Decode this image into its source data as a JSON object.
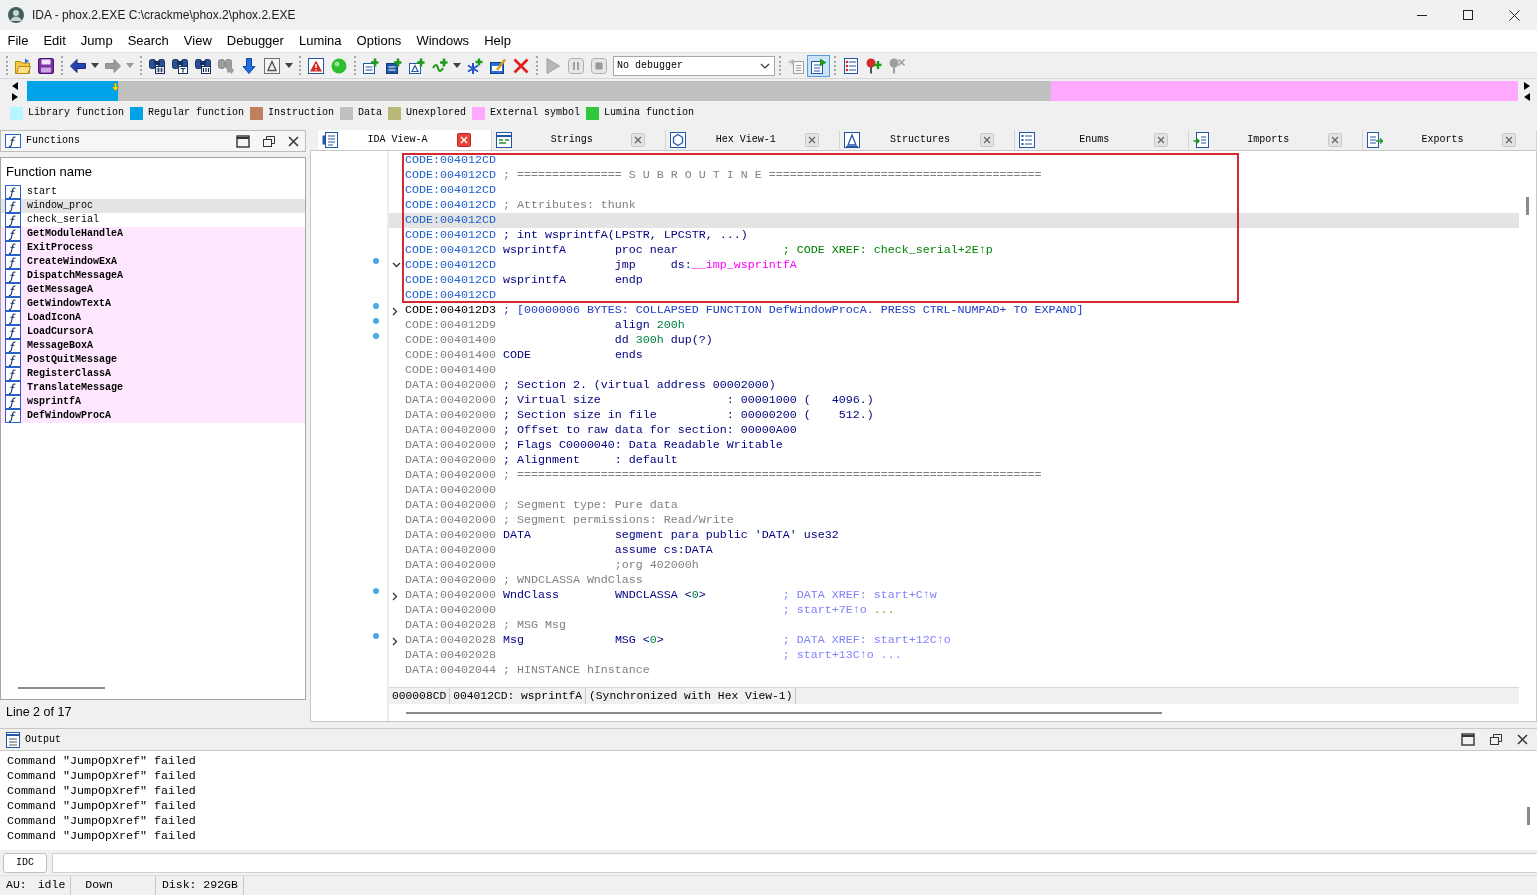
{
  "window": {
    "title": "IDA - phox.2.EXE C:\\crackme\\phox.2\\phox.2.EXE"
  },
  "menu": [
    "File",
    "Edit",
    "Jump",
    "Search",
    "View",
    "Debugger",
    "Lumina",
    "Options",
    "Windows",
    "Help"
  ],
  "toolbar": [
    [
      {
        "kind": "open",
        "disabled": false,
        "pressed": false
      },
      {
        "kind": "save",
        "disabled": false,
        "pressed": false
      }
    ],
    [
      {
        "kind": "back",
        "disabled": false,
        "pressed": false
      },
      {
        "kind": "caret",
        "disabled": false,
        "pressed": false
      },
      {
        "kind": "forward",
        "disabled": true,
        "pressed": false
      },
      {
        "kind": "caret",
        "disabled": true,
        "pressed": false
      }
    ],
    [
      {
        "kind": "find_code",
        "disabled": false,
        "pressed": false
      },
      {
        "kind": "find_text",
        "disabled": false,
        "pressed": false
      },
      {
        "kind": "find_bytes",
        "disabled": false,
        "pressed": false
      },
      {
        "kind": "find_next",
        "disabled": true,
        "pressed": false
      },
      {
        "kind": "jump_down",
        "disabled": false,
        "pressed": false
      },
      {
        "kind": "text_style",
        "disabled": false,
        "pressed": false
      },
      {
        "kind": "caret",
        "disabled": false,
        "pressed": false
      }
    ],
    [
      {
        "kind": "warning",
        "disabled": false,
        "pressed": false
      },
      {
        "kind": "light",
        "disabled": false,
        "pressed": false
      }
    ],
    [
      {
        "kind": "make_code",
        "disabled": false,
        "pressed": false
      },
      {
        "kind": "make_data",
        "disabled": false,
        "pressed": false
      },
      {
        "kind": "make_string",
        "disabled": false,
        "pressed": false
      },
      {
        "kind": "make_struct",
        "disabled": false,
        "pressed": false
      },
      {
        "kind": "caret",
        "disabled": false,
        "pressed": false
      },
      {
        "kind": "make_enum",
        "disabled": false,
        "pressed": false
      },
      {
        "kind": "edit",
        "disabled": false,
        "pressed": false
      },
      {
        "kind": "undefine",
        "disabled": false,
        "pressed": false
      }
    ],
    [
      {
        "kind": "play",
        "disabled": true,
        "pressed": false
      },
      {
        "kind": "pause",
        "disabled": true,
        "pressed": false
      },
      {
        "kind": "stop",
        "disabled": true,
        "pressed": false
      },
      {
        "kind": "combo",
        "disabled": false,
        "pressed": false,
        "value": "No debugger"
      }
    ],
    [
      {
        "kind": "attach",
        "disabled": true,
        "pressed": false
      },
      {
        "kind": "sync",
        "disabled": false,
        "pressed": true
      }
    ],
    [
      {
        "kind": "breakpoints",
        "disabled": false,
        "pressed": false
      },
      {
        "kind": "add_breakpoint",
        "disabled": false,
        "pressed": false
      },
      {
        "kind": "remove_breakpoint",
        "disabled": true,
        "pressed": false
      }
    ]
  ],
  "legend": [
    {
      "label": "Library function",
      "color": "#b8f6ff"
    },
    {
      "label": "Regular function",
      "color": "#00a2e8"
    },
    {
      "label": "Instruction",
      "color": "#c08060"
    },
    {
      "label": "Data",
      "color": "#c0c0c0"
    },
    {
      "label": "Unexplored",
      "color": "#b8b878"
    },
    {
      "label": "External symbol",
      "color": "#ffa8ff"
    },
    {
      "label": "Lumina function",
      "color": "#30c83c"
    }
  ],
  "functions": {
    "title": "Functions",
    "column": "Function name",
    "rows": [
      {
        "name": "start",
        "kind": "regular",
        "selected": false
      },
      {
        "name": "window_proc",
        "kind": "regular",
        "selected": true
      },
      {
        "name": "check_serial",
        "kind": "regular",
        "selected": false
      },
      {
        "name": "GetModuleHandleA",
        "kind": "import",
        "selected": false
      },
      {
        "name": "ExitProcess",
        "kind": "import",
        "selected": false
      },
      {
        "name": "CreateWindowExA",
        "kind": "import",
        "selected": false
      },
      {
        "name": "DispatchMessageA",
        "kind": "import",
        "selected": false
      },
      {
        "name": "GetMessageA",
        "kind": "import",
        "selected": false
      },
      {
        "name": "GetWindowTextA",
        "kind": "import",
        "selected": false
      },
      {
        "name": "LoadIconA",
        "kind": "import",
        "selected": false
      },
      {
        "name": "LoadCursorA",
        "kind": "import",
        "selected": false
      },
      {
        "name": "MessageBoxA",
        "kind": "import",
        "selected": false
      },
      {
        "name": "PostQuitMessage",
        "kind": "import",
        "selected": false
      },
      {
        "name": "RegisterClassA",
        "kind": "import",
        "selected": false
      },
      {
        "name": "TranslateMessage",
        "kind": "import",
        "selected": false
      },
      {
        "name": "wsprintfA",
        "kind": "import",
        "selected": false
      },
      {
        "name": "DefWindowProcA",
        "kind": "import",
        "selected": false
      }
    ],
    "status": "Line 2 of 17"
  },
  "tabs": [
    {
      "label": "IDA View-A",
      "kind": "disassembly",
      "selected": true
    },
    {
      "label": "Strings",
      "kind": "strings",
      "selected": false
    },
    {
      "label": "Hex View-1",
      "kind": "hex",
      "selected": false
    },
    {
      "label": "Structures",
      "kind": "structures",
      "selected": false
    },
    {
      "label": "Enums",
      "kind": "enums",
      "selected": false
    },
    {
      "label": "Imports",
      "kind": "imports",
      "selected": false
    },
    {
      "label": "Exports",
      "kind": "exports",
      "selected": false
    }
  ],
  "listing": {
    "highlight_box": {
      "lines": [
        {
          "address": {
            "text": "CODE:004012CD",
            "kind": "function"
          },
          "selected": false,
          "dot": false
        },
        {
          "address": {
            "text": "CODE:004012CD",
            "kind": "function"
          },
          "selected": false,
          "dot": false,
          "label": [
            {
              "text": "; =============== S U B R O U T I N E =======================================",
              "kind": "comment"
            }
          ]
        },
        {
          "address": {
            "text": "CODE:004012CD",
            "kind": "function"
          },
          "selected": false,
          "dot": false
        },
        {
          "address": {
            "text": "CODE:004012CD",
            "kind": "function"
          },
          "selected": false,
          "dot": false,
          "label": [
            {
              "text": "; Attributes: thunk",
              "kind": "comment"
            }
          ]
        },
        {
          "address": {
            "text": "CODE:004012CD",
            "kind": "function"
          },
          "selected": true,
          "dot": false
        },
        {
          "address": {
            "text": "CODE:004012CD",
            "kind": "function"
          },
          "selected": false,
          "dot": false,
          "label": [
            {
              "text": "; int wsprintfA(LPSTR, LPCSTR, ...)",
              "kind": "note"
            }
          ]
        },
        {
          "address": {
            "text": "CODE:004012CD",
            "kind": "function"
          },
          "selected": false,
          "dot": false,
          "label": [
            {
              "text": "wsprintfA",
              "kind": "name"
            }
          ],
          "code": [
            {
              "text": "proc near",
              "kind": "keyword"
            }
          ],
          "comment": [
            {
              "text": "; CODE XREF: check_serial+2E↑p",
              "kind": "code_xref"
            }
          ]
        },
        {
          "address": {
            "text": "CODE:004012CD",
            "kind": "function"
          },
          "selected": false,
          "dot": true,
          "expanded": true,
          "code": [
            {
              "text": "jmp",
              "kind": "mnemonic"
            },
            {
              "text": "ds:",
              "kind": "keyword"
            },
            {
              "text": "__imp_wsprintfA",
              "kind": "import"
            }
          ]
        },
        {
          "address": {
            "text": "CODE:004012CD",
            "kind": "function"
          },
          "selected": false,
          "dot": false,
          "label": [
            {
              "text": "wsprintfA",
              "kind": "name"
            }
          ],
          "code": [
            {
              "text": "endp",
              "kind": "keyword"
            }
          ]
        },
        {
          "address": {
            "text": "CODE:004012CD",
            "kind": "function"
          },
          "selected": false,
          "dot": false
        }
      ]
    },
    "lines": [
      {
        "address": {
          "text": "CODE:004012D3",
          "kind": "current"
        },
        "selected": false,
        "dot": true,
        "expanded": false,
        "label": [
          {
            "text": "; [00000006 BYTES: COLLAPSED FUNCTION DefWindowProcA. PRESS CTRL-NUMPAD+ TO EXPAND]",
            "kind": "collapsed"
          }
        ]
      },
      {
        "address": {
          "text": "CODE:004012D9",
          "kind": "plain"
        },
        "selected": false,
        "dot": true,
        "code": [
          {
            "text": "align ",
            "kind": "keyword"
          },
          {
            "text": "200h",
            "kind": "number"
          }
        ]
      },
      {
        "address": {
          "text": "CODE:00401400",
          "kind": "plain"
        },
        "selected": false,
        "dot": true,
        "code": [
          {
            "text": "dd ",
            "kind": "keyword"
          },
          {
            "text": "300h",
            "kind": "number"
          },
          {
            "text": " dup(?)",
            "kind": "keyword"
          }
        ]
      },
      {
        "address": {
          "text": "CODE:00401400",
          "kind": "plain"
        },
        "selected": false,
        "dot": false,
        "label": [
          {
            "text": "CODE",
            "kind": "name"
          }
        ],
        "code": [
          {
            "text": "ends",
            "kind": "keyword"
          }
        ]
      },
      {
        "address": {
          "text": "CODE:00401400",
          "kind": "plain"
        },
        "selected": false,
        "dot": false
      },
      {
        "address": {
          "text": "DATA:00402000",
          "kind": "plain"
        },
        "selected": false,
        "dot": false,
        "label": [
          {
            "text": "; Section 2. (virtual address 00002000)",
            "kind": "note"
          }
        ]
      },
      {
        "address": {
          "text": "DATA:00402000",
          "kind": "plain"
        },
        "selected": false,
        "dot": false,
        "label": [
          {
            "text": "; Virtual size                  : 00001000 (   4096.)",
            "kind": "note"
          }
        ]
      },
      {
        "address": {
          "text": "DATA:00402000",
          "kind": "plain"
        },
        "selected": false,
        "dot": false,
        "label": [
          {
            "text": "; Section size in file          : 00000200 (    512.)",
            "kind": "note"
          }
        ]
      },
      {
        "address": {
          "text": "DATA:00402000",
          "kind": "plain"
        },
        "selected": false,
        "dot": false,
        "label": [
          {
            "text": "; Offset to raw data for section: 00000A00",
            "kind": "note"
          }
        ]
      },
      {
        "address": {
          "text": "DATA:00402000",
          "kind": "plain"
        },
        "selected": false,
        "dot": false,
        "label": [
          {
            "text": "; Flags C0000040: Data Readable Writable",
            "kind": "note"
          }
        ]
      },
      {
        "address": {
          "text": "DATA:00402000",
          "kind": "plain"
        },
        "selected": false,
        "dot": false,
        "label": [
          {
            "text": "; Alignment     : default",
            "kind": "note"
          }
        ]
      },
      {
        "address": {
          "text": "DATA:00402000",
          "kind": "plain"
        },
        "selected": false,
        "dot": false,
        "label": [
          {
            "text": "; ===========================================================================",
            "kind": "comment"
          }
        ]
      },
      {
        "address": {
          "text": "DATA:00402000",
          "kind": "plain"
        },
        "selected": false,
        "dot": false
      },
      {
        "address": {
          "text": "DATA:00402000",
          "kind": "plain"
        },
        "selected": false,
        "dot": false,
        "label": [
          {
            "text": "; Segment type: Pure data",
            "kind": "comment"
          }
        ]
      },
      {
        "address": {
          "text": "DATA:00402000",
          "kind": "plain"
        },
        "selected": false,
        "dot": false,
        "label": [
          {
            "text": "; Segment permissions: Read/Write",
            "kind": "comment"
          }
        ]
      },
      {
        "address": {
          "text": "DATA:00402000",
          "kind": "plain"
        },
        "selected": false,
        "dot": false,
        "label": [
          {
            "text": "DATA",
            "kind": "name"
          }
        ],
        "code": [
          {
            "text": "segment para public 'DATA' use32",
            "kind": "keyword"
          }
        ]
      },
      {
        "address": {
          "text": "DATA:00402000",
          "kind": "plain"
        },
        "selected": false,
        "dot": false,
        "code": [
          {
            "text": "assume cs:DATA",
            "kind": "keyword"
          }
        ]
      },
      {
        "address": {
          "text": "DATA:00402000",
          "kind": "plain"
        },
        "selected": false,
        "dot": false,
        "code": [
          {
            "text": ";org 402000h",
            "kind": "comment"
          }
        ]
      },
      {
        "address": {
          "text": "DATA:00402000",
          "kind": "plain"
        },
        "selected": false,
        "dot": false,
        "label": [
          {
            "text": "; WNDCLASSA WndClass",
            "kind": "comment"
          }
        ]
      },
      {
        "address": {
          "text": "DATA:00402000",
          "kind": "plain"
        },
        "selected": false,
        "dot": true,
        "expanded": false,
        "label": [
          {
            "text": "WndClass",
            "kind": "name"
          }
        ],
        "code": [
          {
            "text": "WNDCLASSA <",
            "kind": "keyword"
          },
          {
            "text": "0",
            "kind": "number"
          },
          {
            "text": ">",
            "kind": "keyword"
          }
        ],
        "comment": [
          {
            "text": "; DATA XREF: start+C↑w",
            "kind": "data_xref"
          }
        ]
      },
      {
        "address": {
          "text": "DATA:00402000",
          "kind": "plain"
        },
        "selected": false,
        "dot": false,
        "comment": [
          {
            "text": "; start+7E↑o ",
            "kind": "data_xref"
          },
          {
            "text": "...",
            "kind": "ellipsis"
          }
        ]
      },
      {
        "address": {
          "text": "DATA:00402028",
          "kind": "plain"
        },
        "selected": false,
        "dot": false,
        "label": [
          {
            "text": "; MSG Msg",
            "kind": "comment"
          }
        ]
      },
      {
        "address": {
          "text": "DATA:00402028",
          "kind": "plain"
        },
        "selected": false,
        "dot": true,
        "expanded": false,
        "label": [
          {
            "text": "Msg",
            "kind": "name"
          }
        ],
        "code": [
          {
            "text": "MSG <",
            "kind": "keyword"
          },
          {
            "text": "0",
            "kind": "number"
          },
          {
            "text": ">",
            "kind": "keyword"
          }
        ],
        "comment": [
          {
            "text": "; DATA XREF: start+12C↑o",
            "kind": "data_xref"
          }
        ]
      },
      {
        "address": {
          "text": "DATA:00402028",
          "kind": "plain"
        },
        "selected": false,
        "dot": false,
        "comment": [
          {
            "text": "; start+13C↑o ...",
            "kind": "data_xref"
          }
        ]
      },
      {
        "address": {
          "text": "DATA:00402044",
          "kind": "plain"
        },
        "selected": false,
        "dot": false,
        "label": [
          {
            "text": "; HINSTANCE hInstance",
            "kind": "comment"
          }
        ]
      }
    ],
    "status": [
      "000008CD",
      "004012CD: wsprintfA",
      "(Synchronized with Hex View-1)"
    ]
  },
  "output": {
    "title": "Output",
    "lines": [
      "Command \"JumpOpXref\" failed",
      "Command \"JumpOpXref\" failed",
      "Command \"JumpOpXref\" failed",
      "Command \"JumpOpXref\" failed",
      "Command \"JumpOpXref\" failed",
      "Command \"JumpOpXref\" failed"
    ]
  },
  "command_bar": {
    "language": "IDC"
  },
  "status_bar": {
    "au_label": "AU:",
    "au_state": "idle",
    "direction": "Down",
    "disk": "Disk: 292GB"
  }
}
